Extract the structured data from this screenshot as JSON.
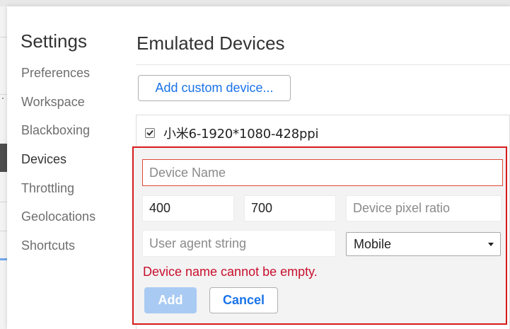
{
  "settings": {
    "title": "Settings",
    "nav": [
      {
        "label": "Preferences",
        "active": false
      },
      {
        "label": "Workspace",
        "active": false
      },
      {
        "label": "Blackboxing",
        "active": false
      },
      {
        "label": "Devices",
        "active": true
      },
      {
        "label": "Throttling",
        "active": false
      },
      {
        "label": "Geolocations",
        "active": false
      },
      {
        "label": "Shortcuts",
        "active": false
      }
    ]
  },
  "emulated_devices": {
    "title": "Emulated Devices",
    "add_custom_label": "Add custom device...",
    "devices": [
      {
        "name": "小米6-1920*1080-428ppi",
        "checked": true
      }
    ]
  },
  "editor": {
    "name_placeholder": "Device Name",
    "name_value": "",
    "width_value": "400",
    "height_value": "700",
    "dpr_placeholder": "Device pixel ratio",
    "ua_placeholder": "User agent string",
    "type_selected": "Mobile",
    "error_message": "Device name cannot be empty.",
    "add_label": "Add",
    "cancel_label": "Cancel"
  },
  "colors": {
    "accent": "#1a73e8",
    "error": "#c8102e",
    "highlight_border": "#d81b1b",
    "disabled_button": "#a9cbf3"
  },
  "icons": {
    "device_checkbox": "checkmark-icon",
    "type_dropdown": "caret-down-icon"
  }
}
